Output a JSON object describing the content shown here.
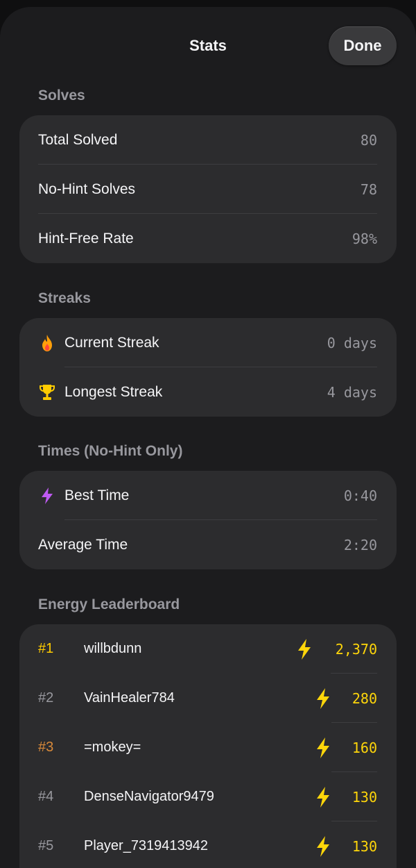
{
  "header": {
    "title": "Stats",
    "done_label": "Done"
  },
  "solves": {
    "title": "Solves",
    "rows": [
      {
        "label": "Total Solved",
        "value": "80"
      },
      {
        "label": "No-Hint Solves",
        "value": "78"
      },
      {
        "label": "Hint-Free Rate",
        "value": "98%"
      }
    ]
  },
  "streaks": {
    "title": "Streaks",
    "rows": [
      {
        "icon": "flame-icon",
        "label": "Current Streak",
        "value": "0 days"
      },
      {
        "icon": "trophy-icon",
        "label": "Longest Streak",
        "value": "4 days"
      }
    ]
  },
  "times": {
    "title": "Times (No-Hint Only)",
    "rows": [
      {
        "icon": "bolt-icon",
        "label": "Best Time",
        "value": "0:40"
      },
      {
        "label": "Average Time",
        "value": "2:20"
      }
    ]
  },
  "leaderboard": {
    "title": "Energy Leaderboard",
    "entries": [
      {
        "rank": "#1",
        "name": "willbdunn",
        "energy": "2,370"
      },
      {
        "rank": "#2",
        "name": "VainHealer784",
        "energy": "280"
      },
      {
        "rank": "#3",
        "name": "=mokey=",
        "energy": "160"
      },
      {
        "rank": "#4",
        "name": "DenseNavigator9479",
        "energy": "130"
      },
      {
        "rank": "#5",
        "name": "Player_7319413942",
        "energy": "130"
      }
    ]
  },
  "colors": {
    "background": "#1c1c1e",
    "card": "#2c2c2e",
    "accent_gold": "#ffd60a",
    "rank1": "#ffcc00",
    "rank3": "#d98a3a",
    "best_time_icon": "#bf5af2",
    "flame": "#ff9f0a"
  }
}
